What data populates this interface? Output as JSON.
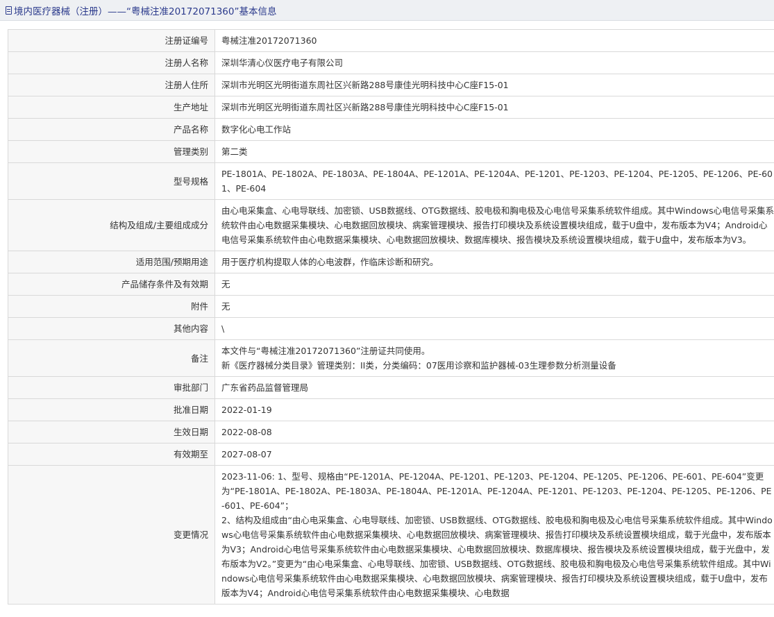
{
  "header": {
    "icon": "document-icon",
    "title": "境内医疗器械（注册）——“粤械注准20172071360”基本信息"
  },
  "rows": [
    {
      "key": "注册证编号",
      "value": "粤械注准20172071360"
    },
    {
      "key": "注册人名称",
      "value": "深圳华清心仪医疗电子有限公司"
    },
    {
      "key": "注册人住所",
      "value": "深圳市光明区光明街道东周社区兴新路288号康佳光明科技中心C座F15-01"
    },
    {
      "key": "生产地址",
      "value": "深圳市光明区光明街道东周社区兴新路288号康佳光明科技中心C座F15-01"
    },
    {
      "key": "产品名称",
      "value": "数字化心电工作站"
    },
    {
      "key": "管理类别",
      "value": "第二类"
    },
    {
      "key": "型号规格",
      "value": "PE-1801A、PE-1802A、PE-1803A、PE-1804A、PE-1201A、PE-1204A、PE-1201、PE-1203、PE-1204、PE-1205、PE-1206、PE-601、PE-604"
    },
    {
      "key": "结构及组成/主要组成成分",
      "value": "由心电采集盒、心电导联线、加密锁、USB数据线、OTG数据线、胶电极和胸电极及心电信号采集系统软件组成。其中Windows心电信号采集系统软件由心电数据采集模块、心电数据回放模块、病案管理模块、报告打印模块及系统设置模块组成，载于U盘中，发布版本为V4；Android心电信号采集系统软件由心电数据采集模块、心电数据回放模块、数据库模块、报告模块及系统设置模块组成，载于U盘中，发布版本为V3。"
    },
    {
      "key": "适用范围/预期用途",
      "value": "用于医疗机构提取人体的心电波群，作临床诊断和研究。"
    },
    {
      "key": "产品储存条件及有效期",
      "value": "无"
    },
    {
      "key": "附件",
      "value": "无"
    },
    {
      "key": "其他内容",
      "value": "\\"
    },
    {
      "key": "备注",
      "lines": [
        "本文件与“粤械注准20172071360”注册证共同使用。",
        "新《医疗器械分类目录》管理类别：II类，分类编码：07医用诊察和监护器械-03生理参数分析测量设备"
      ]
    },
    {
      "key": "审批部门",
      "value": "广东省药品监督管理局"
    },
    {
      "key": "批准日期",
      "value": "2022-01-19"
    },
    {
      "key": "生效日期",
      "value": "2022-08-08"
    },
    {
      "key": "有效期至",
      "value": "2027-08-07"
    },
    {
      "key": "变更情况",
      "lines": [
        "2023-11-06: 1、型号、规格由“PE-1201A、PE-1204A、PE-1201、PE-1203、PE-1204、PE-1205、PE-1206、PE-601、PE-604”变更为“PE-1801A、PE-1802A、PE-1803A、PE-1804A、PE-1201A、PE-1204A、PE-1201、PE-1203、PE-1204、PE-1205、PE-1206、PE-601、PE-604”；",
        "2、结构及组成由“由心电采集盒、心电导联线、加密锁、USB数据线、OTG数据线、胶电极和胸电极及心电信号采集系统软件组成。其中Windows心电信号采集系统软件由心电数据采集模块、心电数据回放模块、病案管理模块、报告打印模块及系统设置模块组成，载于光盘中，发布版本为V3；Android心电信号采集系统软件由心电数据采集模块、心电数据回放模块、数据库模块、报告模块及系统设置模块组成，载于光盘中，发布版本为V2。”变更为“由心电采集盒、心电导联线、加密锁、USB数据线、OTG数据线、胶电极和胸电极及心电信号采集系统软件组成。其中Windows心电信号采集系统软件由心电数据采集模块、心电数据回放模块、病案管理模块、报告打印模块及系统设置模块组成，载于U盘中，发布版本为V4；Android心电信号采集系统软件由心电数据采集模块、心电数据"
      ]
    }
  ]
}
